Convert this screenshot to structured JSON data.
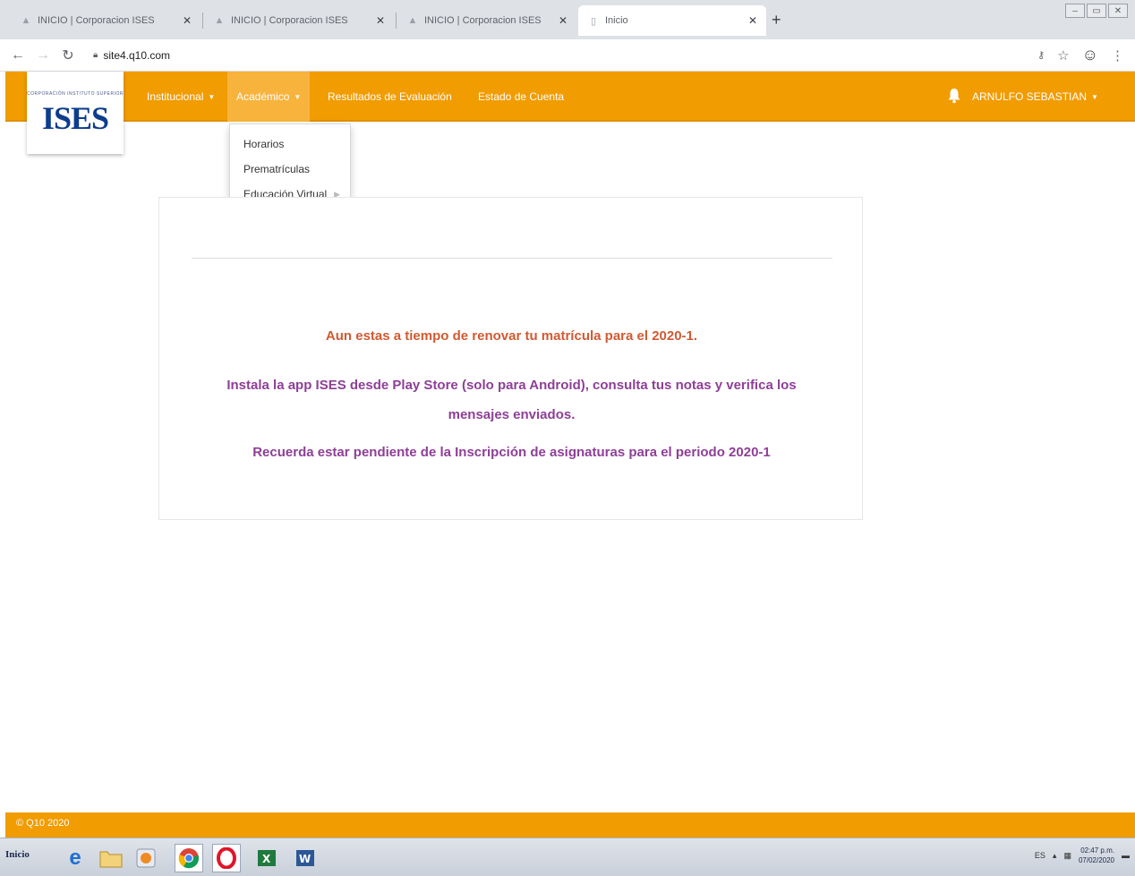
{
  "browser": {
    "tabs": [
      {
        "title": "INICIO | Corporacion ISES",
        "active": false
      },
      {
        "title": "INICIO | Corporacion ISES",
        "active": false
      },
      {
        "title": "INICIO | Corporacion ISES",
        "active": false
      },
      {
        "title": "Inicio",
        "active": true
      }
    ],
    "url": "site4.q10.com"
  },
  "site": {
    "logo_text": "ISES",
    "logo_subtext": "CORPORACIÓN INSTITUTO SUPERIOR",
    "nav": {
      "institucional": "Institucional",
      "academico": "Académico",
      "resultados": "Resultados de Evaluación",
      "estado_cuenta": "Estado de Cuenta",
      "user": "ARNULFO SEBASTIAN"
    },
    "dropdown": {
      "items": [
        "Horarios",
        "Prematrículas",
        "Educación Virtual"
      ]
    },
    "messages": {
      "renewal": "Aun estas a tiempo de renovar tu matrícula para el 2020-1.",
      "app": "Instala la app ISES desde Play Store (solo para Android), consulta tus notas y verifica los mensajes enviados.",
      "enrollment": "Recuerda estar pendiente de la Inscripción de asignaturas para el periodo 2020-1"
    },
    "footer": "© Q10 2020"
  },
  "colors": {
    "brand_orange": "#f19c00",
    "logo_blue": "#0d3d8c",
    "message_orange": "#d15a32",
    "message_purple": "#8e3f97"
  },
  "taskbar": {
    "start_label": "Inicio",
    "language": "ES",
    "time": "02:47 p.m.",
    "date": "07/02/2020"
  }
}
